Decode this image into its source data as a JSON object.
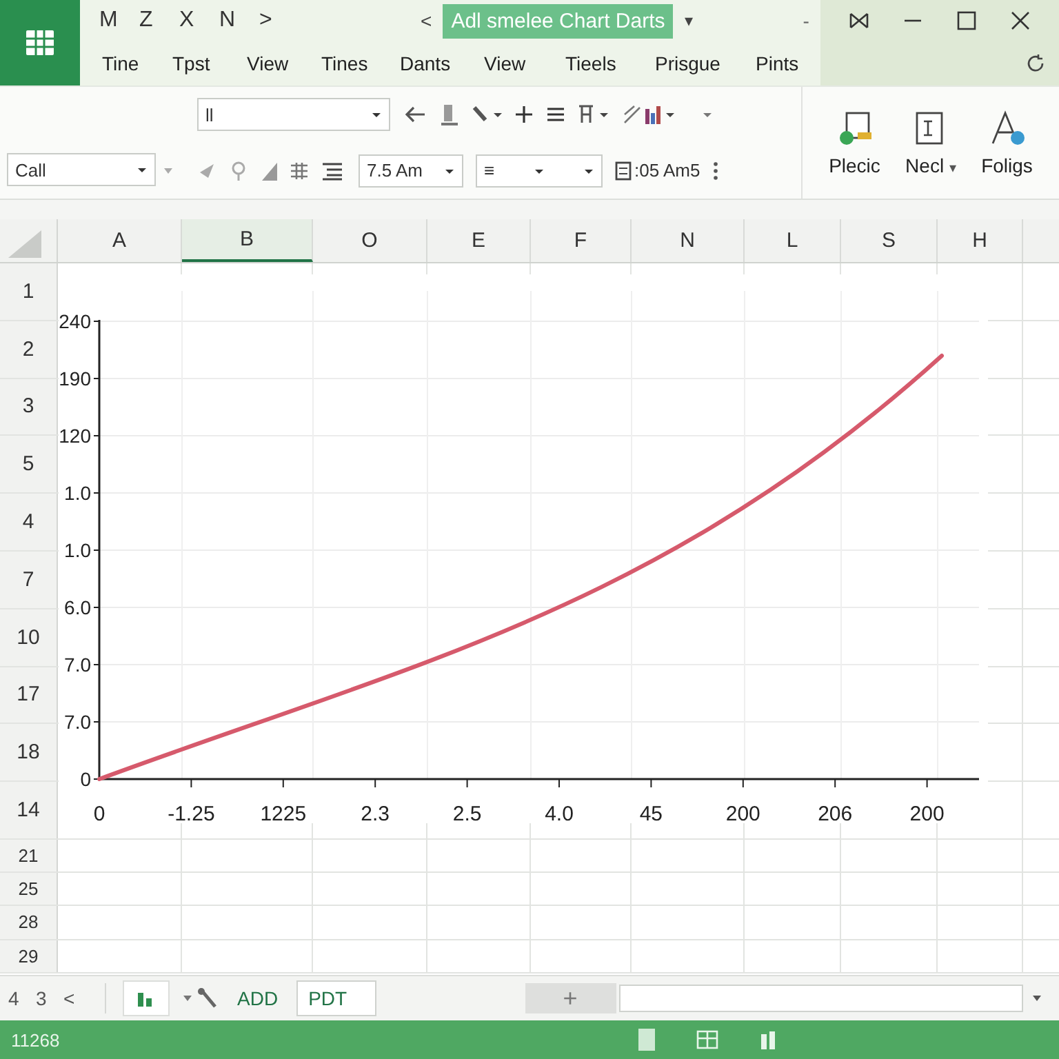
{
  "app_bar": {
    "quick_access": [
      "M",
      "Z",
      "X",
      "N",
      ">"
    ],
    "back": "<",
    "title": "Adl smelee Chart Darts",
    "title_caret": "▾",
    "dash": "-"
  },
  "menu_tabs": [
    {
      "label": "Tine",
      "selected": false
    },
    {
      "label": "Tpst",
      "selected": false
    },
    {
      "label": "View",
      "selected": false
    },
    {
      "label": "Tines",
      "selected": false
    },
    {
      "label": "Dants",
      "selected": false
    },
    {
      "label": "View",
      "selected": false
    },
    {
      "label": "Tieels",
      "selected": false
    },
    {
      "label": "Prisgue",
      "selected": false
    },
    {
      "label": "Pints",
      "selected": false
    }
  ],
  "ribbon": {
    "cell_box": "Call",
    "font_box": "ll",
    "size_box": "7.5 Am",
    "align_box": "≡",
    "format_text": ":05 Am5",
    "big_buttons": [
      {
        "label": "Plecic"
      },
      {
        "label": "Necl",
        "caret": "▾"
      },
      {
        "label": "Foligs"
      }
    ]
  },
  "columns": [
    {
      "label": "A",
      "selected": false
    },
    {
      "label": "B",
      "selected": true
    },
    {
      "label": "O",
      "selected": false
    },
    {
      "label": "E",
      "selected": false
    },
    {
      "label": "F",
      "selected": false
    },
    {
      "label": "N",
      "selected": false
    },
    {
      "label": "L",
      "selected": false
    },
    {
      "label": "S",
      "selected": false
    },
    {
      "label": "H",
      "selected": false
    }
  ],
  "chart_rows": [
    "1",
    "2",
    "3",
    "5",
    "4",
    "7",
    "10",
    "17",
    "18",
    "14"
  ],
  "rows_below": [
    "21",
    "25",
    "28",
    "29"
  ],
  "chart": {
    "y_labels": [
      "240",
      "190",
      "120",
      "1.0",
      "1.0",
      "6.0",
      "7.0",
      "7.0",
      "0"
    ],
    "x_labels": [
      "0",
      "-1.25",
      "1225",
      "2.3",
      "2.5",
      "4.0",
      "45",
      "200",
      "206",
      "200"
    ]
  },
  "sheet_bar": {
    "nav": [
      "4",
      "3",
      "<"
    ],
    "tabs": [
      {
        "label": "ADD",
        "selected": false
      },
      {
        "label": "PDT",
        "selected": true
      }
    ],
    "add": "+"
  },
  "status_bar": {
    "text": "11268"
  }
}
